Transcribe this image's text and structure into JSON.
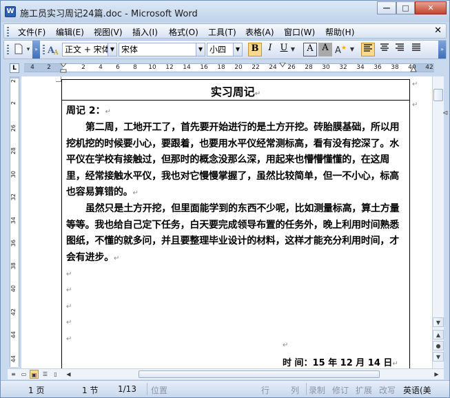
{
  "window": {
    "title": "施工员实习周记24篇.doc - Microsoft Word",
    "app_icon": "W",
    "minimize": "—",
    "maximize": "□",
    "close": "✕"
  },
  "menu": {
    "items": [
      "文件(F)",
      "编辑(E)",
      "视图(V)",
      "插入(I)",
      "格式(O)",
      "工具(T)",
      "表格(A)",
      "窗口(W)",
      "帮助(H)"
    ],
    "close": "✕"
  },
  "toolbar": {
    "style_value": "正文 + 宋体",
    "font_value": "宋体",
    "size_value": "小四",
    "bold": "B",
    "italic": "I",
    "underline": "U",
    "border_char": "A",
    "shade_char": "A",
    "highlight_char": "A"
  },
  "ruler": {
    "corner": "L",
    "h_ticks": [
      "4",
      "2",
      "2",
      "4",
      "6",
      "8",
      "10",
      "12",
      "14",
      "16",
      "18",
      "20",
      "22",
      "24",
      "26",
      "28",
      "30",
      "32",
      "34",
      "36",
      "38",
      "40",
      "42"
    ],
    "v_ticks": [
      "2",
      "1",
      "2",
      "4",
      "6",
      "8",
      "10",
      "12",
      "14",
      "16",
      "18",
      "20",
      "22",
      "24",
      "26",
      "28",
      "30",
      "32",
      "34",
      "36",
      "38",
      "40",
      "42",
      "44"
    ]
  },
  "document": {
    "title": "实习周记",
    "week_label": "周记 2：",
    "paragraph1": "第二周，工地开工了，首先要开始进行的是土方开挖。砖胎膜基础，所以用挖机挖的时候要小心，要跟着，也要用水平仪经常测标高，看有没有挖深了。水平仪在学校有接触过，但那时的概念没那么深，用起来也懵懵懂懂的，在这周里，经常接触水平仪，我也对它慢慢掌握了，虽然比较简单，但一不小心，标高也容易算错的。",
    "paragraph2": "虽然只是土方开挖，但里面能学到的东西不少呢，比如测量标高，算土方量等等。我也给自己定下任务，白天要完成领导布置的任务外，晚上利用时间熟悉图纸，不懂的就多问，并且要整理毕业设计的材料，这样才能充分利用时间，才会有进步。",
    "date_line": "时  间：15  年 12  月 14 日",
    "para_mark": "↵"
  },
  "statusbar": {
    "page": "1 页",
    "section": "1 节",
    "page_of": "1/13",
    "position": "位置",
    "line": "行",
    "column": "列",
    "rec": "录制",
    "trk": "修订",
    "ext": "扩展",
    "ovr": "改写",
    "language": "英语(美"
  }
}
